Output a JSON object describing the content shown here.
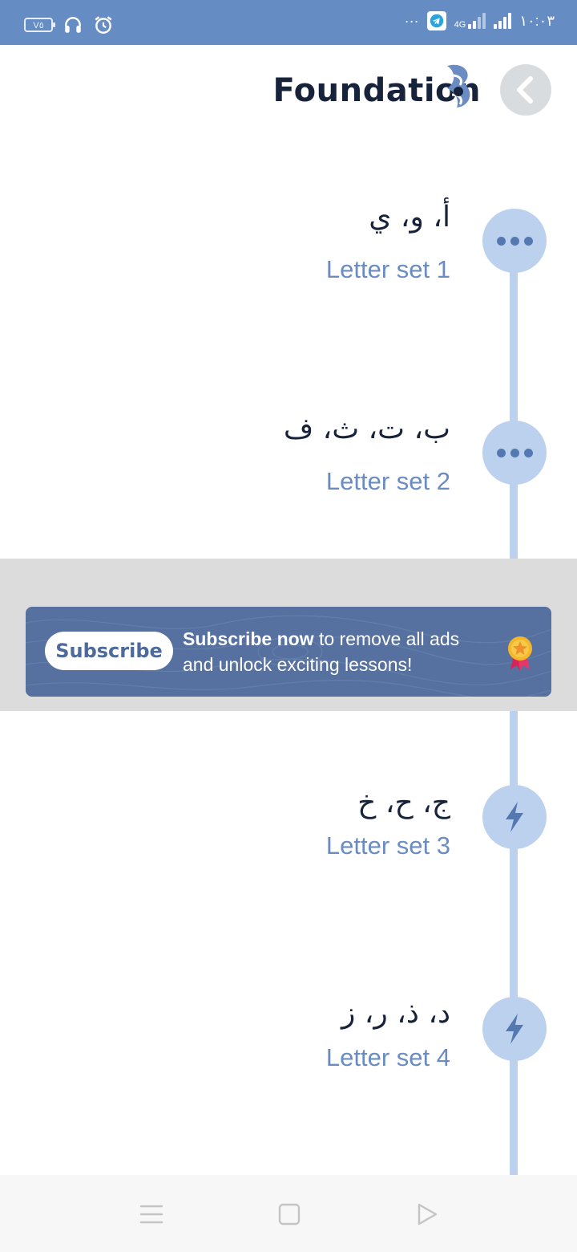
{
  "status_bar": {
    "battery_level": "V٥",
    "network_type": "4G",
    "more_indicator": "···",
    "time": "١٠:٠٣"
  },
  "header": {
    "title": "Foundation"
  },
  "lessons": [
    {
      "letters": "أ، و، ي",
      "label": "Letter set 1",
      "status": "in-progress",
      "icon": "more-dots-icon"
    },
    {
      "letters": "ب، ت، ث، ف",
      "label": "Letter set 2",
      "status": "in-progress",
      "icon": "more-dots-icon"
    },
    {
      "letters": "ج، ح، خ",
      "label": "Letter set 3",
      "status": "locked",
      "icon": "lightning-icon"
    },
    {
      "letters": "د، ذ، ر، ز",
      "label": "Letter set 4",
      "status": "locked",
      "icon": "lightning-icon"
    }
  ],
  "banner": {
    "button_label": "Subscribe",
    "text_bold": "Subscribe now",
    "text_rest": " to remove all ads and unlock exciting lessons!",
    "icon": "medal-icon"
  },
  "colors": {
    "status_bar": "#668cc4",
    "title": "#17223b",
    "timeline": "#bcd1ee",
    "node_icon": "#5479b1",
    "label": "#6a8cc3",
    "banner": "#56719f",
    "ad_background": "#dcdcdc"
  }
}
